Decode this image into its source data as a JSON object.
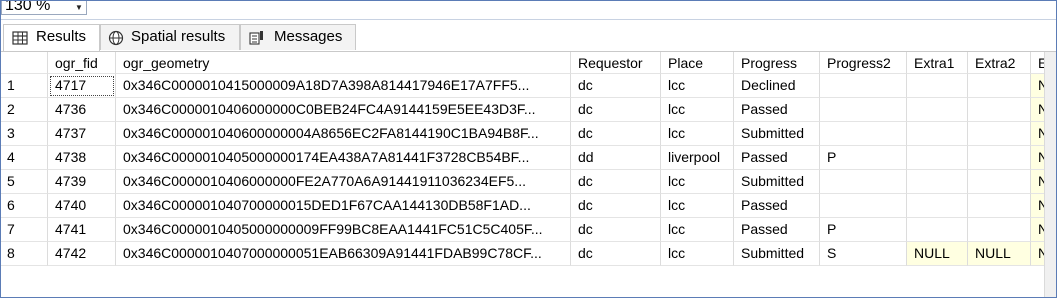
{
  "zoom": {
    "value": "130 %",
    "arrow": "▼"
  },
  "tabs": [
    {
      "label": "Results",
      "icon": "grid-icon"
    },
    {
      "label": "Spatial results",
      "icon": "globe-icon"
    },
    {
      "label": "Messages",
      "icon": "messages-icon"
    }
  ],
  "columns": [
    "ogr_fid",
    "ogr_geometry",
    "Requestor",
    "Place",
    "Progress",
    "Progress2",
    "Extra1",
    "Extra2",
    "Ex"
  ],
  "rows": [
    [
      "1",
      "4717",
      "0x346C0000010415000009A18D7A398A814417946E17A7FF5...",
      "dc",
      "lcc",
      "Declined",
      "",
      "",
      "",
      "NU"
    ],
    [
      "2",
      "4736",
      "0x346C0000010406000000C0BEB24FC4A9144159E5EE43D3F...",
      "dc",
      "lcc",
      "Passed",
      "",
      "",
      "",
      "NU"
    ],
    [
      "3",
      "4737",
      "0x346C000001040600000004A8656EC2FA8144190C1BA94B8F...",
      "dc",
      "lcc",
      "Submitted",
      "",
      "",
      "",
      "NU"
    ],
    [
      "4",
      "4738",
      "0x346C0000010405000000174EA438A7A81441F3728CB54BF...",
      "dd",
      "liverpool",
      "Passed",
      "P",
      "",
      "",
      "NU"
    ],
    [
      "5",
      "4739",
      "0x346C0000010406000000FE2A770A6A91441911036234EF5...",
      "dc",
      "lcc",
      "Submitted",
      "",
      "",
      "",
      "NU"
    ],
    [
      "6",
      "4740",
      "0x346C000001040700000015DED1F67CAA144130DB58F1AD...",
      "dc",
      "lcc",
      "Passed",
      "",
      "",
      "",
      "NU"
    ],
    [
      "7",
      "4741",
      "0x346C0000010405000000009FF99BC8EAA1441FC51C5C405F...",
      "dc",
      "lcc",
      "Passed",
      "P",
      "",
      "",
      "NU"
    ],
    [
      "8",
      "4742",
      "0x346C0000010407000000051EAB66309A91441FDAB99C78CF...",
      "dc",
      "lcc",
      "Submitted",
      "S",
      "NULL",
      "NULL",
      "NU"
    ]
  ]
}
